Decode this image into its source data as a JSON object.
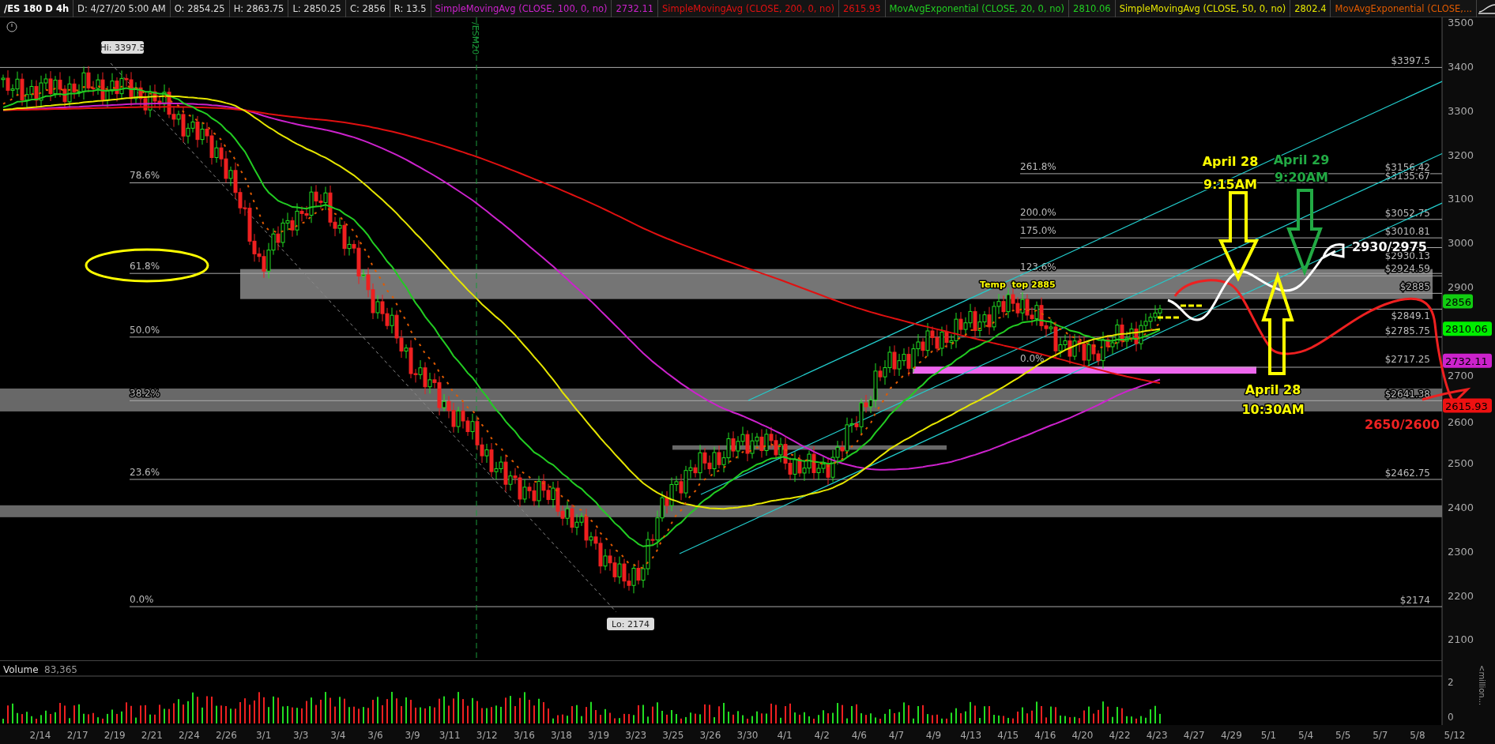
{
  "header": {
    "symbol": "/ES 180 D 4h",
    "fields": [
      "D: 4/27/20 5:00 AM",
      "O: 2854.25",
      "H: 2863.75",
      "L: 2850.25",
      "C: 2856",
      "R: 13.5"
    ],
    "studies": [
      {
        "label": "SimpleMovingAvg (CLOSE, 100, 0, no)",
        "value": "2732.11",
        "color": "#cc22cc"
      },
      {
        "label": "SimpleMovingAvg (CLOSE, 200, 0, no)",
        "value": "2615.93",
        "color": "#e01010"
      },
      {
        "label": "MovAvgExponential (CLOSE, 20, 0, no)",
        "value": "2810.06",
        "color": "#22cc22"
      },
      {
        "label": "SimpleMovingAvg (CLOSE, 50, 0, no)",
        "value": "2802.4",
        "color": "#e6e600"
      },
      {
        "label": "MovAvgExponential (CLOSE,...",
        "color": "#e05a00"
      }
    ]
  },
  "price_axis": {
    "ticks": [
      "3500",
      "3400",
      "3300",
      "3200",
      "3100",
      "3000",
      "2900",
      "2700",
      "2600",
      "2500",
      "2400",
      "2300",
      "2200",
      "2100"
    ]
  },
  "price_tags": [
    {
      "text": "2856",
      "color": "#11cc11"
    },
    {
      "text": "2810.06",
      "color": "#00ee00"
    },
    {
      "text": "2732.11",
      "color": "#cc22cc"
    },
    {
      "text": "2615.93",
      "color": "#ee1111"
    }
  ],
  "levels": [
    {
      "kind": "top",
      "right_label": "$3397.5"
    },
    {
      "kind": "second",
      "left_label": "261.8%",
      "right_label": "$3156.42"
    },
    {
      "kind": "first",
      "left_label": "78.6%",
      "right_label": "$3135.67"
    },
    {
      "kind": "second",
      "left_label": "200.0%",
      "right_label": "$3052.75"
    },
    {
      "kind": "second",
      "left_label": "175.0%",
      "right_label": "$3010.81"
    },
    {
      "kind": "first",
      "left_label": "61.8%",
      "right_label": "$2930.13"
    },
    {
      "kind": "second",
      "left_label": "123.6%",
      "right_label": "$2924.59"
    },
    {
      "kind": "second",
      "right_label": "$2885"
    },
    {
      "kind": "second",
      "right_label": "$2849.1"
    },
    {
      "kind": "first",
      "left_label": "50.0%",
      "right_label": "$2785.75"
    },
    {
      "kind": "second",
      "left_label": "0.0%",
      "right_label": "$2717.25"
    },
    {
      "kind": "first",
      "left_label": "38.2%",
      "right_label": "$2641.38"
    },
    {
      "kind": "first",
      "left_label": "23.6%",
      "right_label": "$2462.75"
    },
    {
      "kind": "first",
      "left_label": "0.0%",
      "right_label": "$2174"
    }
  ],
  "callouts": [
    {
      "text": "Hi: 3397.5"
    },
    {
      "text": "Lo: 2174"
    }
  ],
  "contract_marker": "/ESM20",
  "annotations": [
    {
      "text": "Temp  top 2885",
      "color": "#ffff00"
    },
    {
      "text": "April 28",
      "color": "#ffff00"
    },
    {
      "text": "9:15AM",
      "color": "#ffff00"
    },
    {
      "text": "April 29",
      "color": "#22aa44"
    },
    {
      "text": "9:20AM",
      "color": "#22aa44"
    },
    {
      "text": "2930/2975",
      "color": "#ffffff"
    },
    {
      "text": "April 28",
      "color": "#ffff00"
    },
    {
      "text": "10:30AM",
      "color": "#ffff00"
    },
    {
      "text": "2650/2600",
      "color": "#ee2222"
    }
  ],
  "volume": {
    "title": "Volume",
    "value": "83,365",
    "ticks": [
      "2",
      "0"
    ],
    "unit": "<million..."
  },
  "dates": [
    "2/14",
    "2/17",
    "2/19",
    "2/21",
    "2/24",
    "2/26",
    "3/1",
    "3/3",
    "3/4",
    "3/6",
    "3/9",
    "3/11",
    "3/12",
    "3/16",
    "3/18",
    "3/19",
    "3/23",
    "3/25",
    "3/26",
    "3/30",
    "4/1",
    "4/2",
    "4/6",
    "4/7",
    "4/9",
    "4/13",
    "4/15",
    "4/16",
    "4/20",
    "4/22",
    "4/23",
    "4/27",
    "4/29",
    "5/1",
    "5/4",
    "5/5",
    "5/7",
    "5/8",
    "5/12"
  ]
}
